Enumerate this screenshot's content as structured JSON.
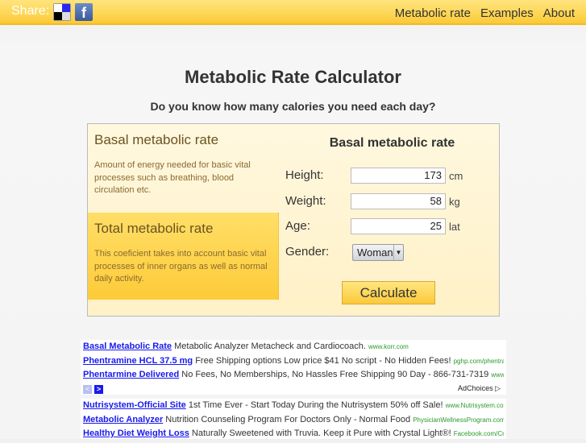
{
  "header": {
    "share_label": "Share:",
    "icons": [
      "delicious-icon",
      "facebook-icon"
    ],
    "nav": [
      "Metabolic rate",
      "Examples",
      "About"
    ]
  },
  "title": "Metabolic Rate Calculator",
  "subtitle": "Do you know how many calories you need each day?",
  "sidebar": {
    "items": [
      {
        "title": "Basal metabolic rate",
        "desc": "Amount of energy needed for basic vital processes such as breathing, blood circulation etc.",
        "selected": false
      },
      {
        "title": "Total metabolic rate",
        "desc": "This coeficient takes into account basic vital processes of inner organs as well as normal daily activity.",
        "selected": true
      }
    ]
  },
  "form": {
    "title": "Basal metabolic rate",
    "height": {
      "label": "Height:",
      "value": "173",
      "unit": "cm"
    },
    "weight": {
      "label": "Weight:",
      "value": "58",
      "unit": "kg"
    },
    "age": {
      "label": "Age:",
      "value": "25",
      "unit": "lat"
    },
    "gender": {
      "label": "Gender:",
      "value": "Woman"
    },
    "calculate": "Calculate"
  },
  "ads1": [
    {
      "title": "Basal Metabolic Rate",
      "text": "Metabolic Analyzer Metacheck and Cardiocoach.",
      "url": "www.korr.com"
    },
    {
      "title": "Phentramine HCL 37.5 mg",
      "text": "Free Shipping options Low price $41 No script - No Hidden Fees!",
      "url": "pghp.com/phentramine"
    },
    {
      "title": "Phentarmine Delivered",
      "text": "No Fees, No Memberships, No Hassles Free Shipping 90 Day - 866-731-7319",
      "url": "www.BestP..."
    }
  ],
  "adchoices": "AdChoices ▷",
  "ads2": [
    {
      "title": "Nutrisystem-Official Site",
      "text": "1st Time Ever - Start Today During the Nutrisystem 50% off Sale!",
      "url": "www.Nutrisystem.com"
    },
    {
      "title": "Metabolic Analyzer",
      "text": "Nutrition Counseling Program For Doctors Only - Normal Food",
      "url": "PhysicianWellnessProgram.com"
    },
    {
      "title": "Healthy Diet Weight Loss",
      "text": "Naturally Sweetened with Truvia. Keep it Pure with Crystal Light®!",
      "url": "Facebook.com/CrystalLi..."
    }
  ]
}
